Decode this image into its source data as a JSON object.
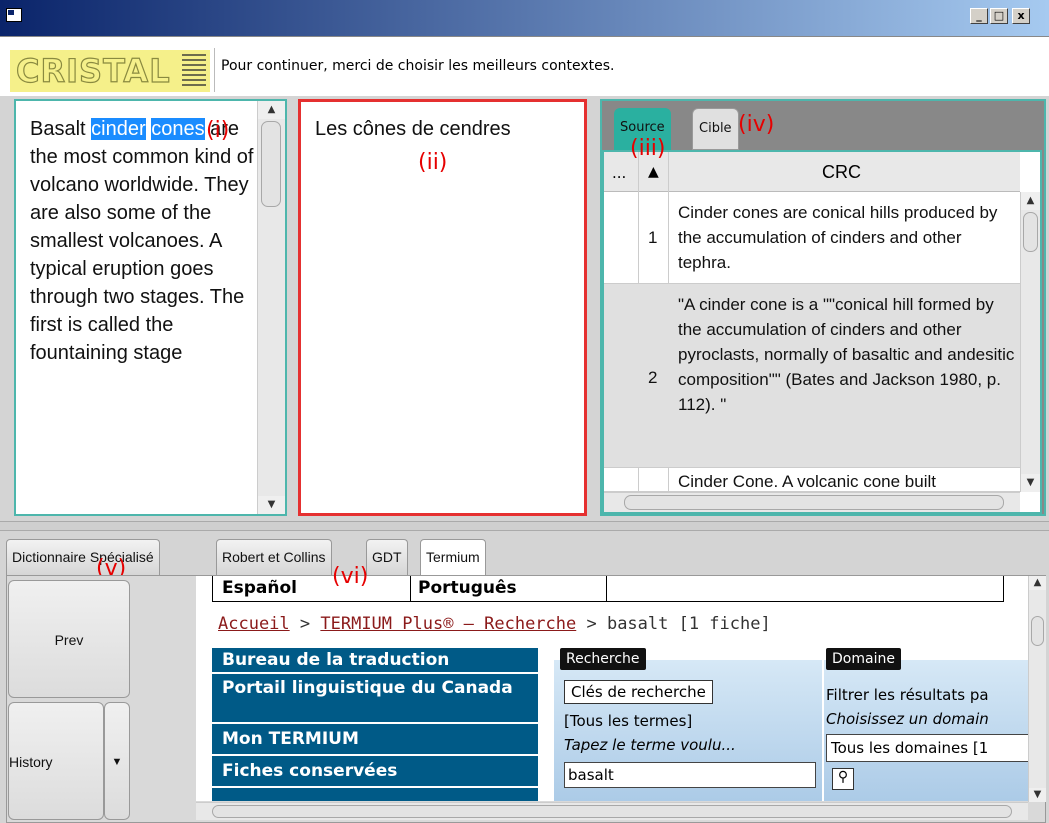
{
  "window": {
    "min": "_",
    "max": "□",
    "close": "x"
  },
  "header": {
    "logo": "CRISTAL",
    "message": "Pour continuer, merci de choisir les meilleurs contextes."
  },
  "source_panel": {
    "before": "Basalt ",
    "hl1": "cinder",
    "hl2": "cones",
    "after": " are the most common kind of volcano worldwide. They are also some of the smallest volcanoes. A typical eruption goes through two stages. The first is called the fountaining stage",
    "marker": "(i)"
  },
  "target_panel": {
    "text": "Les cônes de cendres",
    "marker": "(ii)"
  },
  "tabs": {
    "source": "Source",
    "cible": "Cible",
    "marker_iii": "(iii)",
    "marker_iv": "(iv)"
  },
  "table": {
    "col_dots": "...",
    "col_sort": "▲",
    "col_crc": "CRC",
    "rows": [
      {
        "n": "1",
        "text": "Cinder cones are conical hills produced by the accumulation of cinders and other tephra."
      },
      {
        "n": "2",
        "text": "\"A cinder cone is a \"\"conical hill formed by the accumulation of cinders and other pyroclasts, normally of basaltic and andesitic composition\"\" (Bates and Jackson 1980, p. 112). \""
      },
      {
        "n": "",
        "text": "Cinder Cone. A volcanic cone built"
      }
    ]
  },
  "bottom_tabs": [
    "Dictionnaire Spécialisé",
    "Robert et Collins",
    "GDT",
    "Termium"
  ],
  "markers": {
    "v": "(v)",
    "vi": "(vi)"
  },
  "nav": {
    "prev": "Prev",
    "history": "History",
    "dropdown": "▼"
  },
  "termium": {
    "langs": [
      "Español",
      "Português"
    ],
    "crumb_home": "Accueil",
    "crumb_sep1": " > ",
    "crumb_search": "TERMIUM Plus® – Recherche",
    "crumb_tail": " > basalt [1 fiche]",
    "menu": [
      "Bureau de la traduction",
      "Portail linguistique du Canada",
      "Mon TERMIUM",
      "Fiches conservées"
    ],
    "recherche_label": "Recherche",
    "cles_button": "Clés de recherche",
    "tous_termes": "[Tous les termes]",
    "tapez": "Tapez le terme voulu...",
    "input_value": "basalt",
    "domaine_label": "Domaine",
    "filtrer": "Filtrer les résultats pa",
    "choisissez": "Choisissez un domain",
    "domain_value": "Tous les domaines [1"
  }
}
